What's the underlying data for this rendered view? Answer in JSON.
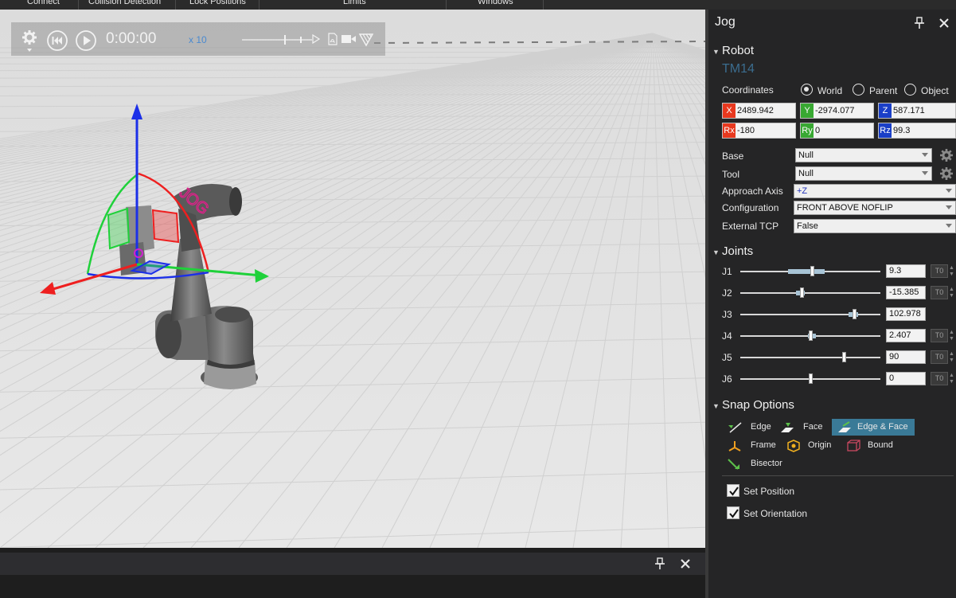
{
  "ribbon": {
    "items": [
      {
        "label": "Connect"
      },
      {
        "label": "Collision Detection"
      },
      {
        "label": "Lock Positions"
      },
      {
        "label": "Limits"
      },
      {
        "label": "Windows"
      }
    ]
  },
  "playback": {
    "time": "0:00:00",
    "speed": "x 10"
  },
  "viewport": {
    "gizmo_label": "JOG"
  },
  "jog": {
    "title": "Jog",
    "robot": {
      "section": "Robot",
      "name": "TM14",
      "coordinates_label": "Coordinates",
      "frames": [
        {
          "label": "World",
          "selected": true
        },
        {
          "label": "Parent",
          "selected": false
        },
        {
          "label": "Object",
          "selected": false
        }
      ],
      "coords": [
        {
          "tag": "X",
          "value": "2489.942",
          "color": "#e8381e"
        },
        {
          "tag": "Y",
          "value": "-2974.077",
          "color": "#38a832"
        },
        {
          "tag": "Z",
          "value": "587.171",
          "color": "#1a3fc8"
        },
        {
          "tag": "Rx",
          "value": "-180",
          "color": "#e8381e"
        },
        {
          "tag": "Ry",
          "value": "0",
          "color": "#38a832"
        },
        {
          "tag": "Rz",
          "value": "99.3",
          "color": "#1a3fc8"
        }
      ],
      "fields": [
        {
          "label": "Base",
          "value": "Null"
        },
        {
          "label": "Tool",
          "value": "Null"
        },
        {
          "label": "Approach Axis",
          "value": "+Z"
        },
        {
          "label": "Configuration",
          "value": "FRONT ABOVE NOFLIP"
        },
        {
          "label": "External TCP",
          "value": "False"
        }
      ]
    },
    "joints": {
      "section": "Joints",
      "to_label": "T0",
      "items": [
        {
          "label": "J1",
          "value": "9.3",
          "pos": 0.51,
          "range": [
            0.34,
            0.6
          ]
        },
        {
          "label": "J2",
          "value": "-15.385",
          "pos": 0.44,
          "range": [
            0.4,
            0.46
          ]
        },
        {
          "label": "J3",
          "value": "102.978",
          "pos": 0.81,
          "range": [
            0.77,
            0.84
          ]
        },
        {
          "label": "J4",
          "value": "2.407",
          "pos": 0.5,
          "range": [
            0.48,
            0.54
          ]
        },
        {
          "label": "J5",
          "value": "90",
          "pos": 0.74,
          "range": null
        },
        {
          "label": "J6",
          "value": "0",
          "pos": 0.5,
          "range": null
        }
      ]
    },
    "snap": {
      "section": "Snap Options",
      "items": [
        {
          "label": "Edge",
          "active": false
        },
        {
          "label": "Face",
          "active": false
        },
        {
          "label": "Edge & Face",
          "active": true
        },
        {
          "label": "Frame",
          "active": false
        },
        {
          "label": "Origin",
          "active": false
        },
        {
          "label": "Bound",
          "active": false
        },
        {
          "label": "Bisector",
          "active": false
        }
      ]
    },
    "options": [
      {
        "label": "Set Position",
        "checked": true
      },
      {
        "label": "Set Orientation",
        "checked": true
      }
    ]
  }
}
